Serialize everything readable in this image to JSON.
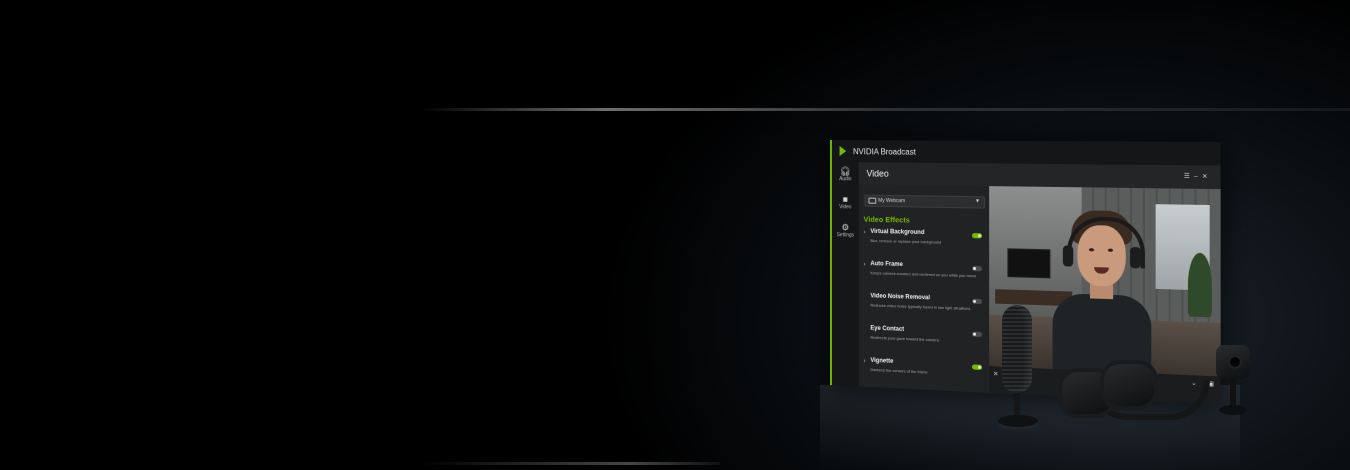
{
  "app": {
    "title": "NVIDIA Broadcast",
    "accent_color": "#76b900"
  },
  "nav": {
    "items": [
      {
        "label": "Audio",
        "icon": "headset-icon"
      },
      {
        "label": "Video",
        "icon": "camera-icon"
      },
      {
        "label": "Settings",
        "icon": "gear-icon"
      }
    ]
  },
  "header": {
    "title": "Video"
  },
  "device": {
    "selected": "My Webcam"
  },
  "effects": {
    "section_title": "Video Effects",
    "items": [
      {
        "name": "Virtual Background",
        "description": "Blur, remove or replace your background",
        "enabled": true
      },
      {
        "name": "Auto Frame",
        "description": "Keeps camera zoomed and centered on you while you move",
        "enabled": false
      },
      {
        "name": "Video Noise Removal",
        "description": "Reduces video noise typically found in low light situations",
        "enabled": false
      },
      {
        "name": "Eye Contact",
        "description": "Redirects your gaze toward the camera",
        "enabled": false
      },
      {
        "name": "Vignette",
        "description": "Darkens the corners of the frame",
        "enabled": true
      }
    ]
  }
}
